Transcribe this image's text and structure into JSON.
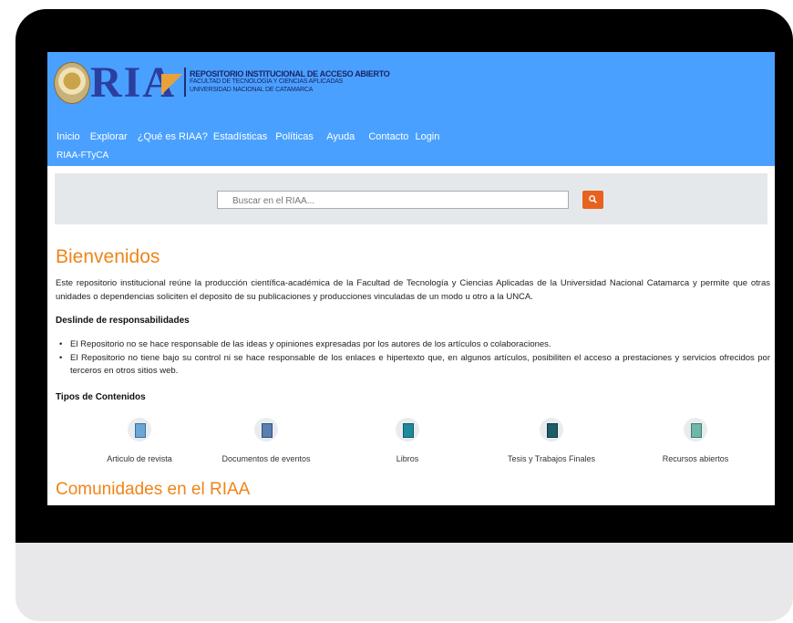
{
  "logo": {
    "acronym": "RIA",
    "institution_line1": "REPOSITORIO INSTITUCIONAL DE ACCESO ABIERTO",
    "institution_line2": "FACULTAD DE TECNOLOGÍA Y CIENCIAS APLICADAS",
    "institution_line3": "UNIVERSIDAD NACIONAL DE CATAMARCA"
  },
  "nav": {
    "items": [
      "Inicio",
      "Explorar",
      "¿Qué es RIAA?",
      "Estadísticas",
      "Políticas",
      "Ayuda",
      "Contacto",
      "Login"
    ]
  },
  "breadcrumb": "RIAA-FTyCA",
  "search": {
    "placeholder": "Buscar en el RIAA...",
    "button_icon": "search-icon"
  },
  "welcome": {
    "title": "Bienvenidos",
    "intro": "Este repositorio institucional reúne la producción científica-académica de la Facultad de Tecnología y Ciencias Aplicadas de la Universidad Nacional Catamarca y permite que otras unidades o dependencias soliciten el deposito de su publicaciones y producciones vinculadas de un modo u otro a la UNCA."
  },
  "disclaimer": {
    "title": "Deslinde de responsabilidades",
    "items": [
      "El Repositorio no se hace responsable de las ideas y opiniones expresadas por los autores de los artículos o colaboraciones.",
      "El Repositorio no tiene bajo su control ni se hace responsable de los enlaces e hipertexto que, en algunos artículos, posibiliten el acceso a prestaciones y servicios ofrecidos por terceros en otros sitios web."
    ]
  },
  "content_types": {
    "title": "Tipos de Contenidos",
    "items": [
      {
        "label": "Articulo de revista",
        "icon": "journal-article-icon"
      },
      {
        "label": "Documentos de eventos",
        "icon": "event-documents-icon"
      },
      {
        "label": "Libros",
        "icon": "book-icon"
      },
      {
        "label": "Tesis y Trabajos Finales",
        "icon": "thesis-icon"
      },
      {
        "label": "Recursos abiertos",
        "icon": "open-resources-icon"
      }
    ]
  },
  "communities": {
    "title": "Comunidades en el RIAA"
  },
  "colors": {
    "header": "#4aa0ff",
    "accent": "#f08418",
    "search_button": "#e8621f",
    "logo": "#2b3f9e"
  }
}
